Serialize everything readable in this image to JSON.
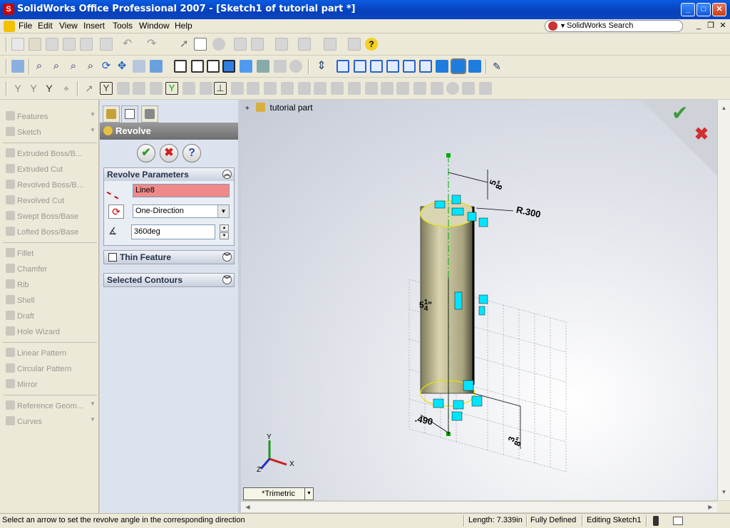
{
  "window": {
    "title": "SolidWorks Office Professional 2007 - [Sketch1 of tutorial part *]"
  },
  "menu": {
    "items": [
      "File",
      "Edit",
      "View",
      "Insert",
      "Tools",
      "Window",
      "Help"
    ],
    "search_label": "SolidWorks Search"
  },
  "command_manager": {
    "items": [
      "Features",
      "Sketch",
      "Extruded Boss/B...",
      "Extruded Cut",
      "Revolved Boss/B...",
      "Revolved Cut",
      "Swept Boss/Base",
      "Lofted Boss/Base",
      "Fillet",
      "Chamfer",
      "Rib",
      "Shell",
      "Draft",
      "Hole Wizard",
      "Linear Pattern",
      "Circular Pattern",
      "Mirror",
      "Reference Geom...",
      "Curves"
    ]
  },
  "property_manager": {
    "title": "Revolve",
    "groups": {
      "revolve_parameters": {
        "label": "Revolve Parameters",
        "axis_value": "Line8",
        "direction_value": "One-Direction",
        "angle_value": "360deg"
      },
      "thin_feature": {
        "label": "Thin Feature"
      },
      "selected_contours": {
        "label": "Selected Contours"
      }
    }
  },
  "viewport": {
    "tree_root": "tutorial part",
    "view_orientation": "*Trimetric",
    "dimensions": {
      "radius": "R.300",
      "top_offset_num": "5",
      "top_offset_den": "8",
      "height_whole": "5",
      "height_num": "1",
      "height_den": "4",
      "bottom_width": ".490",
      "bottom_offset_num": "3",
      "bottom_offset_den": "8",
      "inch": "\""
    },
    "triad": {
      "x": "X",
      "y": "Y",
      "z": "Z"
    }
  },
  "status_bar": {
    "message": "Select an arrow to set the revolve angle in the corresponding direction",
    "length": "Length: 7.339in",
    "state": "Fully Defined",
    "mode": "Editing Sketch1"
  },
  "colors": {
    "title_blue": "#0840b8",
    "selected_field": "#f08a8a",
    "accent_cyan": "#00e5ff",
    "ok_green": "#2e9a2e",
    "cancel_red": "#d02020"
  }
}
